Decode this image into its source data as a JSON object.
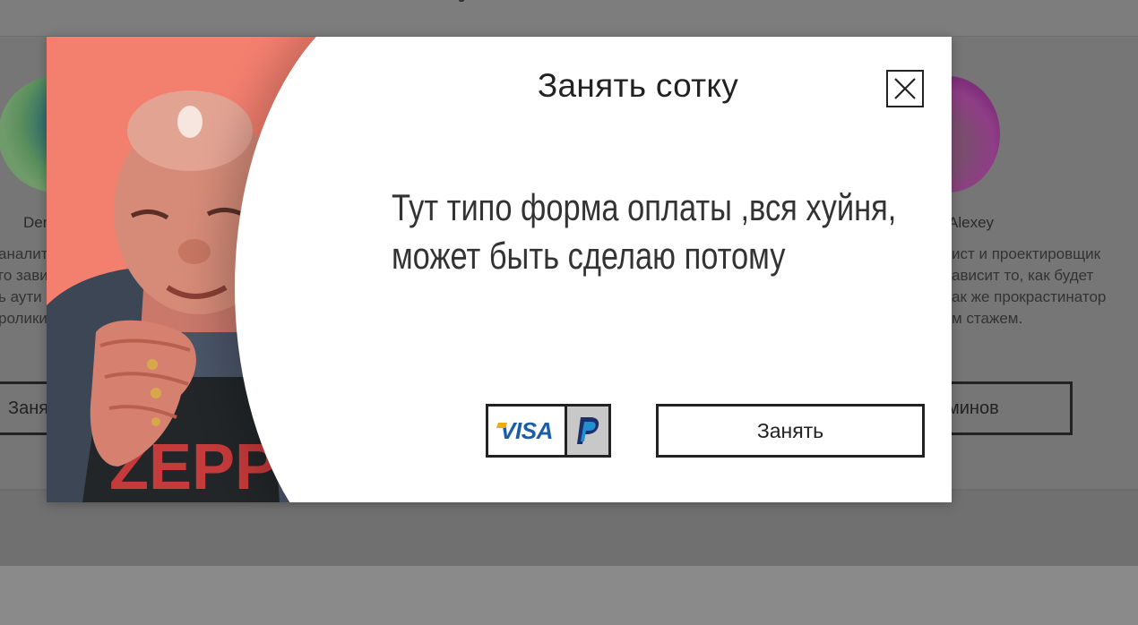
{
  "background": {
    "left_member": {
      "name": "Den",
      "description_lines": [
        "аналит",
        "го зави",
        "ь аути",
        "ролики"
      ],
      "button_label": "Заня"
    },
    "right_member": {
      "name": "Alexey",
      "description_lines": [
        "ист и проектировщик",
        "ависит то, как будет",
        "ак же прокрастинатор",
        "м стажем."
      ],
      "button_label": "минов"
    }
  },
  "modal": {
    "title": "Занять сотку",
    "message_line1": "Тут типо форма оплаты ,вся хуйня,",
    "message_line2": "может быть сделаю потому",
    "payment": {
      "visa_label": "VISA",
      "paypal_icon": "paypal-icon"
    },
    "submit_label": "Занять",
    "close_icon": "close-icon"
  },
  "colors": {
    "visa_blue": "#1a5ea8",
    "visa_gold": "#f0a81d",
    "paypal_dark": "#1b2f6b",
    "paypal_light": "#1f8fd1",
    "photo_bg": "#f47e6e"
  }
}
